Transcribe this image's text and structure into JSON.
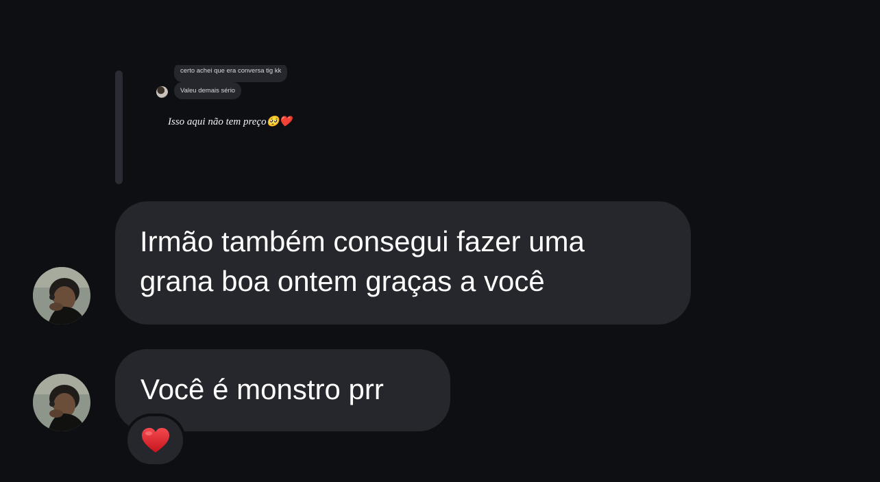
{
  "reply_preview": {
    "messages": [
      {
        "text": "certo achei que era conversa tig kk"
      },
      {
        "text": "Valeu demais sério"
      }
    ],
    "caption": "Isso aqui não tem preço🥺❤️"
  },
  "messages": [
    {
      "lines": [
        "Irmão também consegui fazer uma",
        "grana boa ontem graças a você"
      ]
    },
    {
      "lines": [
        "Você é monstro prr"
      ]
    }
  ],
  "reaction": {
    "emoji": "heart-icon",
    "color": "#e0232b"
  },
  "colors": {
    "background": "#0e0f13",
    "bubble": "#26272c",
    "text": "#ffffff"
  }
}
